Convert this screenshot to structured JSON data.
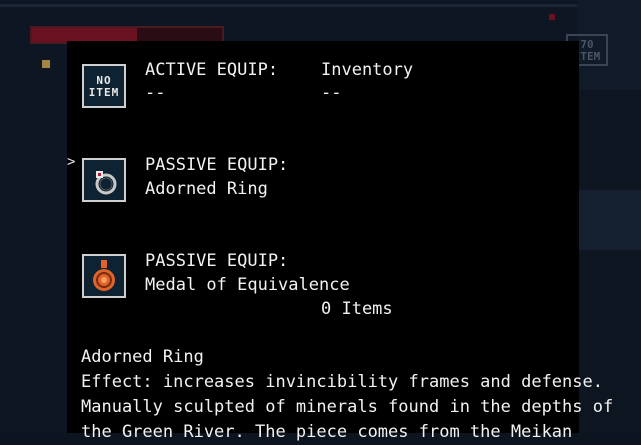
{
  "background": {
    "mini_slot_label_line1": "70",
    "mini_slot_label_line2": "ITEM"
  },
  "active": {
    "icon_label_line1": "NO",
    "icon_label_line2": "ITEM",
    "title": "ACTIVE EQUIP:",
    "value": "--"
  },
  "inventory": {
    "title": "Inventory",
    "value": "--"
  },
  "passive1": {
    "cursor": ">",
    "title": "PASSIVE EQUIP:",
    "value": "Adorned Ring",
    "icon": "ring-icon"
  },
  "passive2": {
    "title": "PASSIVE EQUIP:",
    "value": "Medal of Equivalence",
    "icon": "medal-icon"
  },
  "items_count": "0 Items",
  "description": {
    "name": "Adorned Ring",
    "line1": "Effect: increases invincibility frames and defense.",
    "line2": "Manually sculpted of minerals found in the depths of",
    "line3": "the Green River. The piece comes from the Meikan"
  },
  "colors": {
    "panel": "#000000",
    "slot_border": "#cfcfcf",
    "slot_fill": "#0e2232",
    "medal": "#e0642a"
  }
}
